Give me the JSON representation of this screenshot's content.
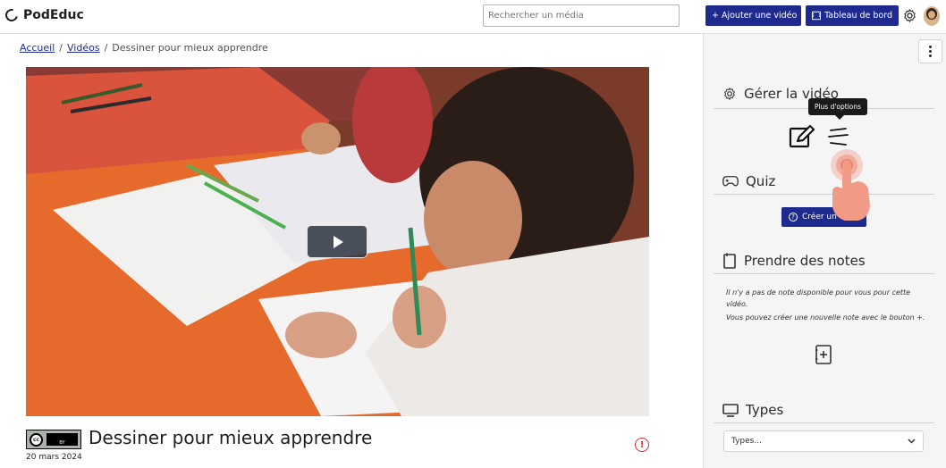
{
  "app": {
    "name": "PodEduc"
  },
  "header": {
    "search_placeholder": "Rechercher un média",
    "add_video_label": "+ Ajouter une vidéo",
    "dashboard_label": "Tableau de bord"
  },
  "breadcrumb": {
    "home": "Accueil",
    "sep": "/",
    "videos": "Vidéos",
    "current": "Dessiner pour mieux apprendre"
  },
  "video": {
    "title": "Dessiner pour mieux apprendre",
    "date": "20 mars 2024",
    "license_badge": "BY"
  },
  "sidebar": {
    "manage_title": "Gérer la vidéo",
    "tooltip": "Plus d'options",
    "quiz_title": "Quiz",
    "quiz_button": "Créer un",
    "notes_title": "Prendre des notes",
    "notes_empty_1": "Il n'y a pas de note disponible pour vous pour cette vidéo.",
    "notes_empty_2": "Vous pouvez créer une nouvelle note avec le bouton +.",
    "types_title": "Types",
    "types_select_value": "Types..."
  },
  "colors": {
    "primary": "#1f2a8f",
    "alert": "#d32f2f",
    "sidebar_bg": "#f5f5f5"
  }
}
